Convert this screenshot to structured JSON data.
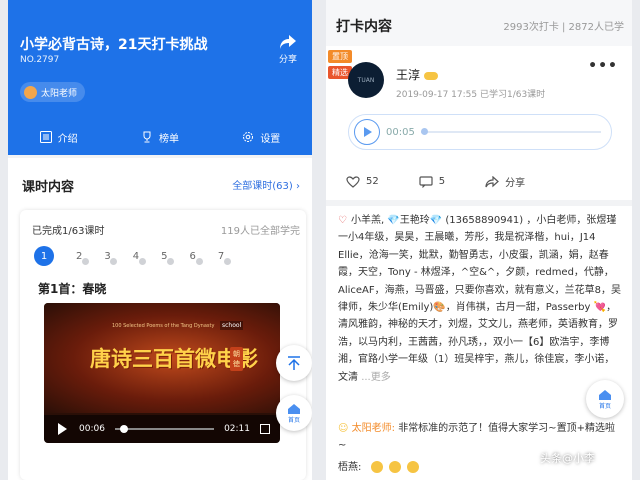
{
  "left": {
    "hero": {
      "title": "小学必背古诗，21天打卡挑战",
      "number": "NO.2797",
      "share_label": "分享",
      "teacher": "太阳老师",
      "tabs": [
        {
          "label": "介绍",
          "icon": "list-icon"
        },
        {
          "label": "榜单",
          "icon": "trophy-icon"
        },
        {
          "label": "设置",
          "icon": "gear-icon"
        }
      ]
    },
    "lessons": {
      "section_title": "课时内容",
      "all_lessons_link": "全部课时(63)",
      "completed": "已完成1/63课时",
      "learned_count": "119人已全部学完",
      "steps": [
        "1",
        "2",
        "3",
        "4",
        "5",
        "6",
        "7"
      ],
      "poem_title": "第1首：春晓",
      "video": {
        "subtitle_en": "100 Selected Poems of the Tang Dynasty",
        "big_text": "唐诗三百首微电影",
        "badge": "朝徳",
        "school": "school",
        "current_time": "00:06",
        "duration": "02:11",
        "progress": 0.05
      }
    },
    "fab": {
      "home_label": "首页"
    }
  },
  "right": {
    "header": {
      "title": "打卡内容",
      "subtitle": "",
      "stats": "2993次打卡 | 2872人已学"
    },
    "post": {
      "tag_top": "置顶",
      "tag_essence": "精选",
      "avatar_text": "TUAN",
      "author": "王淳",
      "meta": "2019-09-17 17:55  已学习1/63课时",
      "audio_time": "00:05",
      "like_count": "52",
      "comment_count": "5",
      "share_label": "分享"
    },
    "likes_text": "小羊羔, 💎王艳玲💎 (13658890941) ，小白老师，张煜瑾 一小4年级，昊昊，王晨曦，芳彤，我是祝泽楷，hui，J14 Ellie，沧海一笑，妣默，勤智勇志，小皮蛋，凯涵，娟，赵春霞，天空，Tony - 林煜泽，^空&^，夕颜，redmed，代静，AliceAF，海燕，马晋盛，只要你喜欢，就有意义，兰花草8，吴律师，朱少华(Emily)🎨，肖伟祺，古月一甜，Passerby 💘，清风雅韵，神秘的天才，刘煜，艾文儿，燕老师，英语教育，罗浩，以马内利，王茜茜，孙凡琇，，双小一【6】欧浩宇，李博湘，官路小学一年级（1）班吴梓宇，燕儿，徐佳宸，李小诺，文清",
    "likes_more": "...更多",
    "comment": {
      "author": "太阳老师:",
      "text": "非常标准的示范了！值得大家学习~置顶+精选啦~"
    },
    "wutong_label": "梧燕:",
    "fab": {
      "home_label": "首页"
    }
  },
  "watermark": "头条@小李"
}
